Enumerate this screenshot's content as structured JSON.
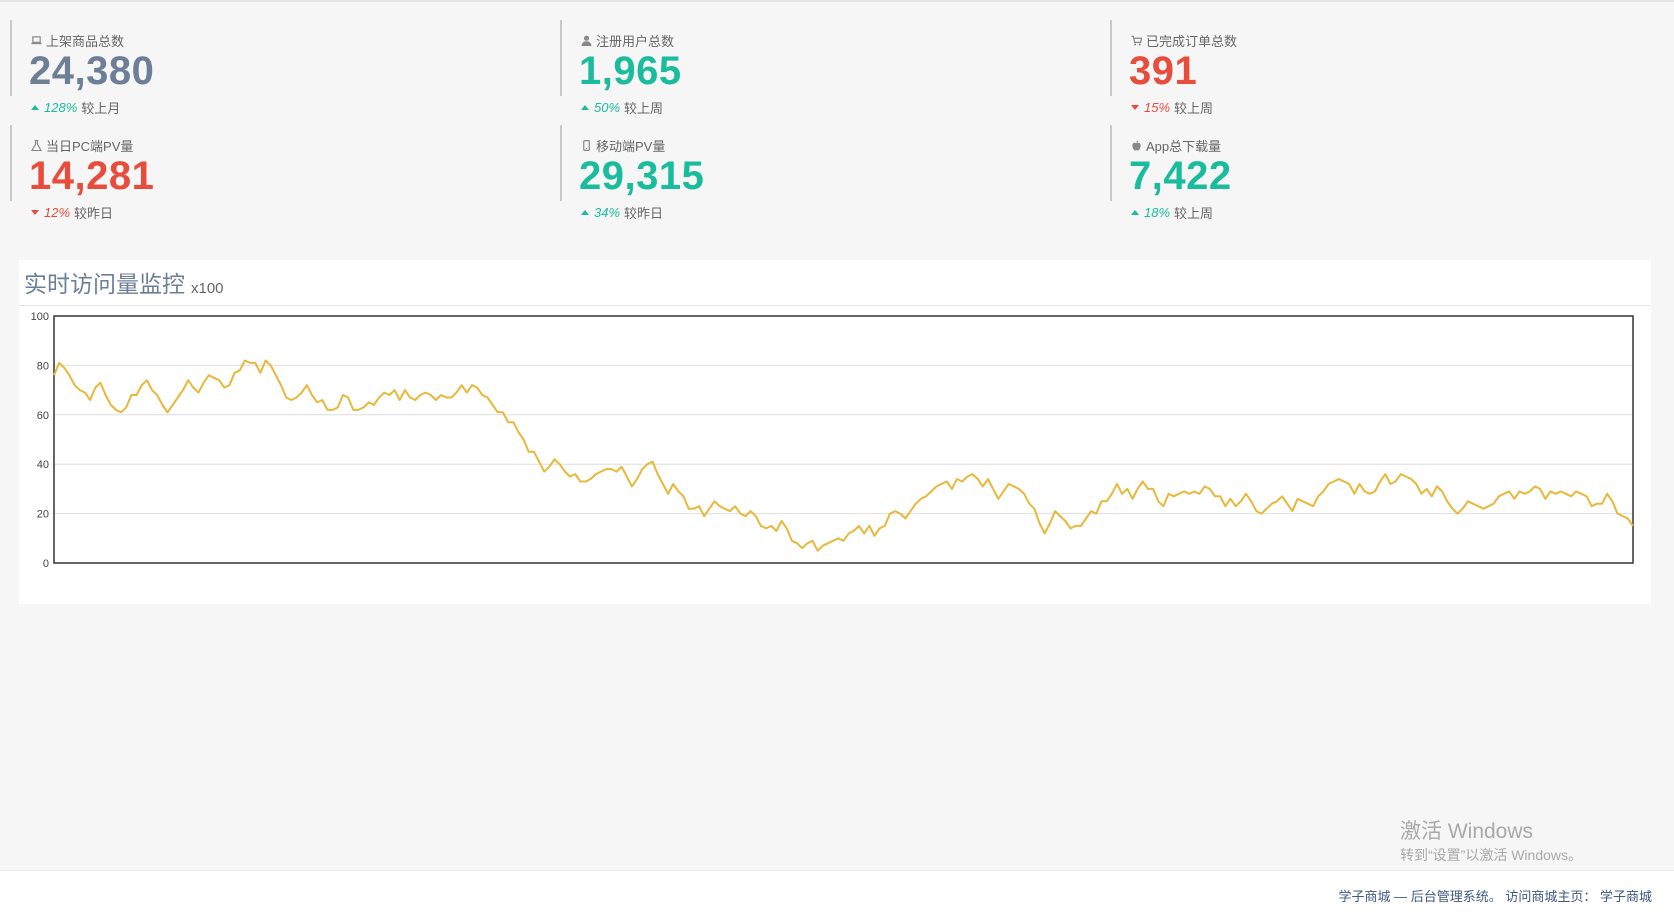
{
  "stats": [
    {
      "label": "上架商品总数",
      "icon": "laptop-icon",
      "value": "24,380",
      "value_color": "#6d7f96",
      "delta": "128%",
      "direction": "up",
      "compare": "较上月",
      "delta_color": "#1abc9c"
    },
    {
      "label": "注册用户总数",
      "icon": "user-icon",
      "value": "1,965",
      "value_color": "#1abc9c",
      "delta": "50%",
      "direction": "up",
      "compare": "较上周",
      "delta_color": "#1abc9c"
    },
    {
      "label": "已完成订单总数",
      "icon": "cart-icon",
      "value": "391",
      "value_color": "#e74c3c",
      "delta": "15%",
      "direction": "down",
      "compare": "较上周",
      "delta_color": "#e74c3c"
    },
    {
      "label": "当日PC端PV量",
      "icon": "beaker-icon",
      "value": "14,281",
      "value_color": "#e74c3c",
      "delta": "12%",
      "direction": "down",
      "compare": "较昨日",
      "delta_color": "#e74c3c"
    },
    {
      "label": "移动端PV量",
      "icon": "mobile-icon",
      "value": "29,315",
      "value_color": "#1abc9c",
      "delta": "34%",
      "direction": "up",
      "compare": "较昨日",
      "delta_color": "#1abc9c"
    },
    {
      "label": "App总下载量",
      "icon": "apple-icon",
      "value": "7,422",
      "value_color": "#1abc9c",
      "delta": "18%",
      "direction": "up",
      "compare": "较上周",
      "delta_color": "#1abc9c"
    }
  ],
  "panel": {
    "title": "实时访问量监控",
    "unit": "x100"
  },
  "chart_data": {
    "type": "line",
    "ylim": [
      0,
      100
    ],
    "yticks": [
      "0",
      "20",
      "40",
      "60",
      "80",
      "100"
    ],
    "grid": true,
    "line_color": "#e8b83b",
    "series": [
      {
        "values": [
          76,
          81,
          79,
          76,
          72,
          70,
          69,
          66,
          71,
          73,
          68,
          64,
          62,
          61,
          63,
          68,
          68,
          72,
          74,
          70,
          68,
          64,
          61,
          64,
          67,
          70,
          74,
          71,
          69,
          73,
          76,
          75,
          74,
          71,
          72,
          77,
          78,
          82,
          81,
          81,
          77,
          82,
          80,
          76,
          72,
          67,
          66,
          67,
          69,
          72,
          68,
          65,
          66,
          62,
          62,
          63,
          68,
          67,
          62,
          62,
          63,
          65,
          64,
          67,
          69,
          68,
          70,
          66,
          70,
          67,
          66,
          68,
          69,
          68,
          66,
          68,
          67,
          67,
          69,
          72,
          69,
          72,
          71,
          68,
          67,
          64,
          61,
          61,
          57,
          57,
          53,
          50,
          45,
          45,
          41,
          37,
          39,
          42,
          40,
          37,
          35,
          36,
          33,
          33,
          34,
          36,
          37,
          38,
          38,
          37,
          39,
          35,
          31,
          34,
          38,
          40,
          41,
          36,
          32,
          28,
          32,
          29,
          27,
          22,
          22,
          23,
          19,
          22,
          25,
          23,
          22,
          21,
          23,
          20,
          19,
          21,
          19,
          15,
          14,
          15,
          13,
          17,
          14,
          9,
          8,
          6,
          8,
          9,
          5,
          7,
          8,
          9,
          10,
          9,
          12,
          13,
          15,
          12,
          15,
          11,
          14,
          15,
          20,
          21,
          20,
          18,
          21,
          24,
          26,
          27,
          29,
          31,
          32,
          33,
          30,
          34,
          33,
          35,
          36,
          34,
          31,
          34,
          30,
          26,
          29,
          32,
          31,
          30,
          28,
          24,
          22,
          16,
          12,
          16,
          21,
          19,
          17,
          14,
          15,
          15,
          18,
          21,
          20,
          25,
          25,
          28,
          32,
          28,
          30,
          26,
          30,
          33,
          30,
          30,
          25,
          23,
          28,
          27,
          28,
          29,
          28,
          29,
          28,
          31,
          30,
          27,
          27,
          23,
          26,
          23,
          25,
          28,
          25,
          21,
          20,
          22,
          24,
          25,
          27,
          24,
          21,
          26,
          25,
          24,
          23,
          27,
          29,
          32,
          33,
          34,
          33,
          32,
          28,
          32,
          29,
          28,
          29,
          33,
          36,
          32,
          33,
          36,
          35,
          34,
          32,
          28,
          30,
          27,
          31,
          29,
          25,
          22,
          20,
          22,
          25,
          24,
          23,
          22,
          23,
          24,
          27,
          28,
          29,
          26,
          29,
          28,
          29,
          31,
          30,
          26,
          29,
          28,
          29,
          28,
          27,
          29,
          28,
          27,
          23,
          24,
          24,
          28,
          25,
          20,
          19,
          18,
          15
        ]
      }
    ]
  },
  "watermark": {
    "title": "激活 Windows",
    "subtitle": "转到“设置”以激活 Windows。"
  },
  "footer": {
    "text": "学子商城 — 后台管理系统。 访问商城主页：",
    "link": "学子商城"
  }
}
